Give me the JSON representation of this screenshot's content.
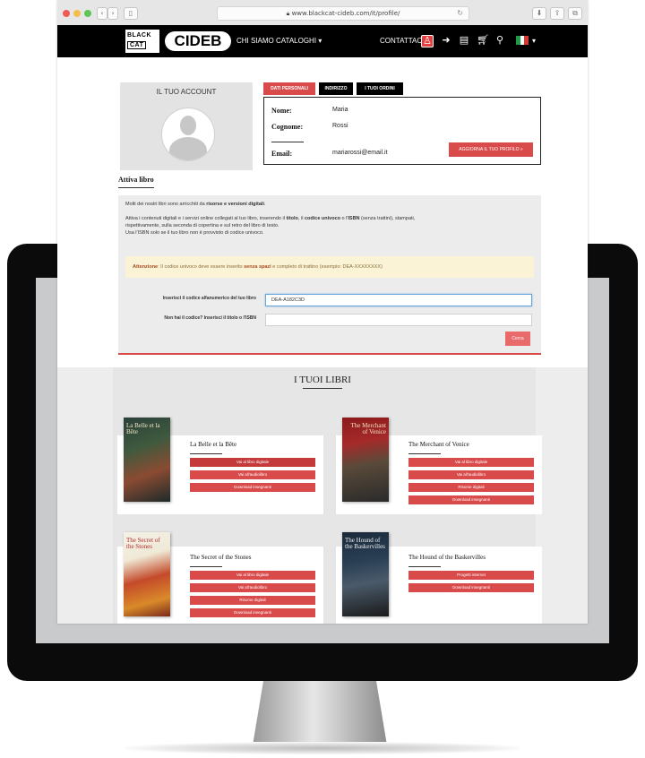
{
  "browser": {
    "url": "www.blackcat-cideb.com/it/profile/"
  },
  "header": {
    "logo_black_1": "BLACK",
    "logo_black_2": "CAT",
    "logo_cideb": "CIDEB",
    "nav_chi_siamo": "CHI SIAMO",
    "nav_cataloghi": "CATALOGHI ▾",
    "nav_contattaci": "CONTATTACI",
    "flag_colors": [
      "#1f9a46",
      "#ffffff",
      "#d63a32"
    ]
  },
  "account": {
    "title": "IL TUO ACCOUNT",
    "tabs": [
      "DATI PERSONALI",
      "INDIRIZZO",
      "I TUOI ORDINI"
    ],
    "nome_label": "Nome:",
    "nome_value": "Maria",
    "cognome_label": "Cognome:",
    "cognome_value": "Rossi",
    "email_label": "Email:",
    "email_value": "mariarossi@email.it",
    "update_button": "AGGIORNA IL TUO PROFILO »"
  },
  "attiva": {
    "heading": "Attiva libro",
    "intro_1": "Molti dei nostri libri sono arricchiti da ",
    "intro_1b": "risorse e versioni digitali",
    "intro_1c": ".",
    "para_1a": "Attiva i contenuti digitali e i servizi online collegati al tuo libro, inserendo il ",
    "para_1b": "titolo",
    "para_1c": ", il ",
    "para_1d": "codice univoco",
    "para_1e": " o l'",
    "para_1f": "ISBN",
    "para_1g": " (senza trattini), stampati,",
    "para_2": "rispettivamente, sulla seconda di copertina e sul retro del libro di testo.",
    "para_3": "Usa l'ISBN solo se il tuo libro non è provvisto di codice univoco.",
    "warn_a": "Attenzione",
    "warn_b": ": Il codice univoco deve essere inserito ",
    "warn_c": "senza spazi",
    "warn_d": " e completo di trattino (esempio: DEA-XXXXXXXX)",
    "code_label": "Inserisci il codice alfanumerico del tuo libro",
    "code_value": "DEA-A182C3D",
    "isbn_label": "Non hai il codice? Inserisci il titolo o l'ISBN",
    "isbn_value": "",
    "cerca_button": "Cerca"
  },
  "libri": {
    "title": "I TUOI LIBRI",
    "books": [
      {
        "title": "La Belle et la Bête",
        "cover_title": "La Belle et la Bête",
        "buttons": [
          "Vai al libro digitale",
          "Vai all'audiolibro",
          "Download insegnanti"
        ]
      },
      {
        "title": "The Merchant of Venice",
        "cover_title": "The Merchant of Venice",
        "buttons": [
          "Vai al libro digitale",
          "Vai all'audiolibro",
          "Risorse digitali",
          "Download insegnanti"
        ]
      },
      {
        "title": "The Secret of the Stones",
        "cover_title": "The Secret of the Stones",
        "buttons": [
          "Vai al libro digitale",
          "Vai all'audiolibro",
          "Risorse digitali",
          "Download insegnanti"
        ]
      },
      {
        "title": "The Hound of the Baskervilles",
        "cover_title": "The Hound of the Baskervilles",
        "buttons": [
          "Progetti internet",
          "Download insegnanti"
        ]
      }
    ]
  }
}
